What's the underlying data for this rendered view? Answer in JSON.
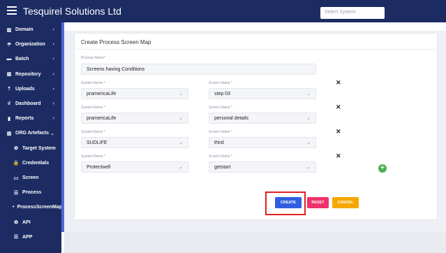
{
  "header": {
    "brand": "Tesquirel Solutions Ltd",
    "system_select_placeholder": "Select System"
  },
  "sidebar": {
    "items": [
      {
        "label": "Domain",
        "icon": "building-icon",
        "chevron": "‹"
      },
      {
        "label": "Organization",
        "icon": "umbrella-icon",
        "chevron": "‹"
      },
      {
        "label": "Batch",
        "icon": "folder-icon",
        "chevron": "‹"
      },
      {
        "label": "Repository",
        "icon": "building-icon",
        "chevron": "‹"
      },
      {
        "label": "Uploads",
        "icon": "upload-icon",
        "chevron": "‹"
      },
      {
        "label": "Dashboard",
        "icon": "bar-chart-icon",
        "chevron": "‹"
      },
      {
        "label": "Reports",
        "icon": "file-icon",
        "chevron": "‹"
      },
      {
        "label": "ORG Artefacts",
        "icon": "building-icon",
        "chevron": "⌄"
      },
      {
        "label": "Target System",
        "icon": "gear-icon"
      },
      {
        "label": "Credentials",
        "icon": "lock-icon"
      },
      {
        "label": "Screen",
        "icon": "monitor-icon"
      },
      {
        "label": "Process",
        "icon": "stack-icon"
      },
      {
        "label": "ProcessScreenMap",
        "icon": "dot-icon"
      },
      {
        "label": "API",
        "icon": "gear-icon"
      },
      {
        "label": "APP",
        "icon": "stack-icon"
      }
    ]
  },
  "card": {
    "title": "Create Process Screen Map",
    "process_name_label": "Process Name*",
    "process_name_value": "Screens having Conditions",
    "system_label": "System Name *",
    "screen_label": "Screen Name *",
    "rows": [
      {
        "system": "pramericaLife",
        "screen": "step 03"
      },
      {
        "system": "pramericaLife",
        "screen": "personal details"
      },
      {
        "system": "SUDLIFE",
        "screen": "third"
      },
      {
        "system": "Protectwell",
        "screen": "getstart"
      }
    ],
    "remove_symbol": "✕",
    "add_symbol": "+",
    "chevron": "⌄"
  },
  "buttons": {
    "create": "CREATE",
    "reset": "RESET",
    "cancel": "CANCEL"
  },
  "colors": {
    "nav": "#1c2c63",
    "create": "#2f5fe0",
    "reset": "#f0316a",
    "cancel": "#f7a800",
    "highlight": "#e02020",
    "add": "#4caf50"
  }
}
